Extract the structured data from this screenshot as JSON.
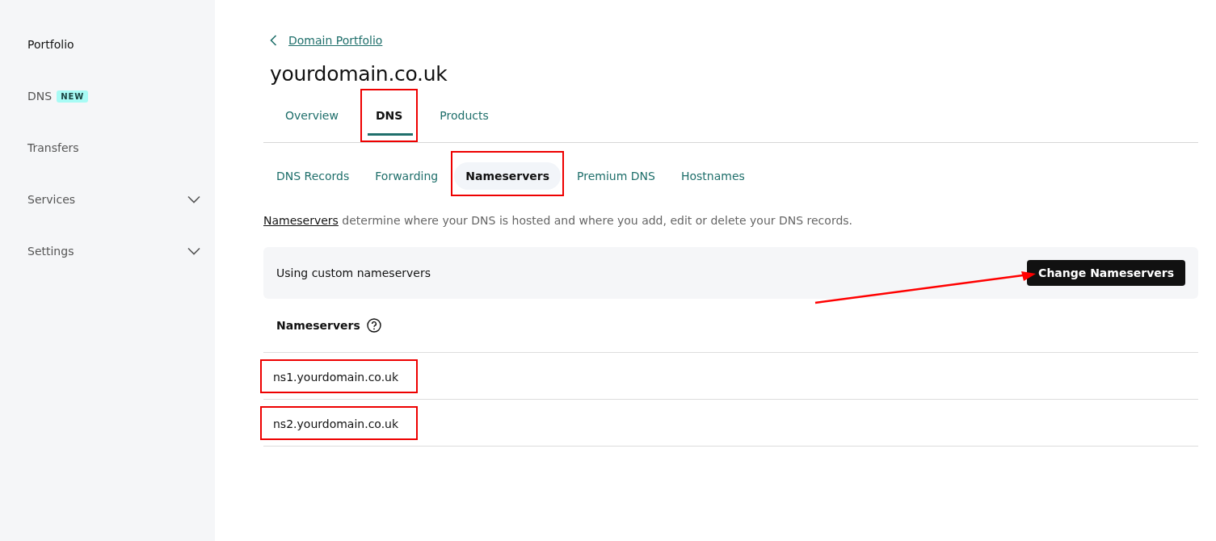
{
  "sidebar": {
    "items": [
      {
        "label": "Portfolio",
        "selected": true
      },
      {
        "label": "DNS",
        "selected": false,
        "badge": "NEW"
      },
      {
        "label": "Transfers",
        "selected": false
      },
      {
        "label": "Services",
        "selected": false,
        "expanded": false
      },
      {
        "label": "Settings",
        "selected": false,
        "expanded": false
      }
    ]
  },
  "breadcrumb": {
    "label": "Domain Portfolio"
  },
  "title": "yourdomain.co.uk",
  "tabs": [
    {
      "label": "Overview",
      "selected": false,
      "highlighted": false
    },
    {
      "label": "DNS",
      "selected": true,
      "highlighted": true
    },
    {
      "label": "Products",
      "selected": false,
      "highlighted": false
    }
  ],
  "subtabs": [
    {
      "label": "DNS Records",
      "selected": false,
      "highlighted": false
    },
    {
      "label": "Forwarding",
      "selected": false,
      "highlighted": false
    },
    {
      "label": "Nameservers",
      "selected": true,
      "highlighted": true
    },
    {
      "label": "Premium DNS",
      "selected": false,
      "highlighted": false
    },
    {
      "label": "Hostnames",
      "selected": false,
      "highlighted": false
    }
  ],
  "description": {
    "link": "Nameservers",
    "text": "determine where your DNS is hosted and where you add, edit or delete your DNS records."
  },
  "status_panel": {
    "text": "Using custom nameservers",
    "button": {
      "label": "Change Nameservers",
      "arrow_annotation": true
    }
  },
  "nameservers": {
    "heading": "Nameservers",
    "rows": [
      {
        "value": "ns1.yourdomain.co.uk",
        "highlighted": true
      },
      {
        "value": "ns2.yourdomain.co.uk",
        "highlighted": true
      }
    ]
  }
}
